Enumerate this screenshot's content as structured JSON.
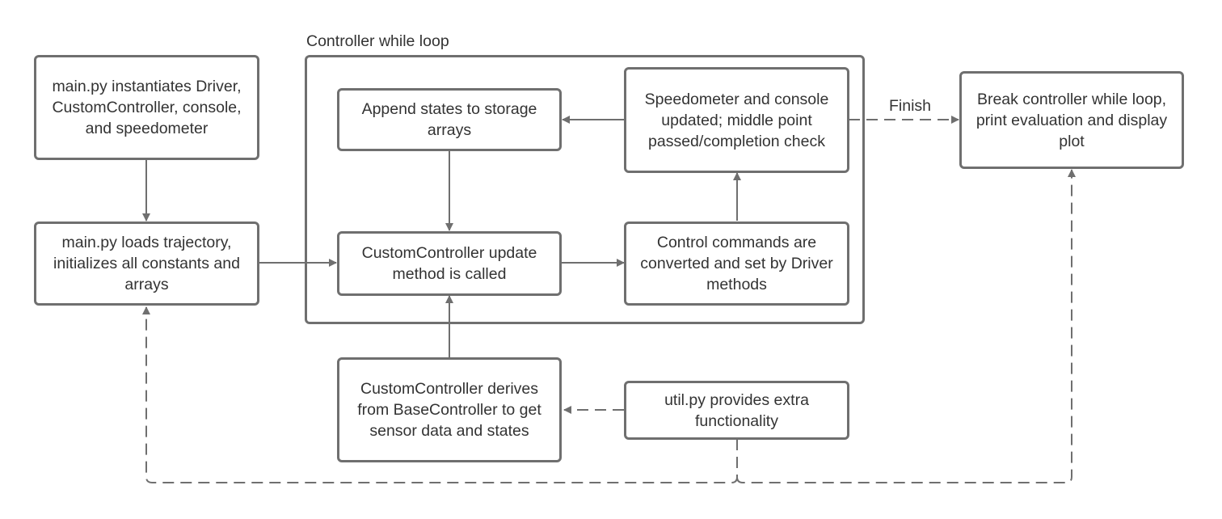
{
  "diagram": {
    "container": {
      "label": "Controller while loop"
    },
    "nodes": {
      "main_instantiates": "main.py instantiates Driver, CustomController, console, and speedometer",
      "main_loads": "main.py loads trajectory, initializes all constants and arrays",
      "append_states": "Append states to storage arrays",
      "speedometer_updated": "Speedometer and console updated; middle point passed/completion check",
      "update_called": "CustomController update method is called",
      "control_commands": "Control commands are converted and set by Driver methods",
      "derives_base": "CustomController derives from BaseController to get sensor data and states",
      "util_provides": "util.py provides extra functionality",
      "break_loop": "Break controller while loop, print evaluation and display plot"
    },
    "edge_labels": {
      "finish": "Finish"
    },
    "edges": [
      {
        "from": "main_instantiates",
        "to": "main_loads",
        "style": "solid"
      },
      {
        "from": "main_loads",
        "to": "update_called",
        "style": "solid"
      },
      {
        "from": "update_called",
        "to": "control_commands",
        "style": "solid"
      },
      {
        "from": "control_commands",
        "to": "speedometer_updated",
        "style": "solid"
      },
      {
        "from": "speedometer_updated",
        "to": "append_states",
        "style": "solid"
      },
      {
        "from": "append_states",
        "to": "update_called",
        "style": "solid"
      },
      {
        "from": "derives_base",
        "to": "update_called",
        "style": "solid"
      },
      {
        "from": "speedometer_updated",
        "to": "break_loop",
        "style": "dashed",
        "label": "Finish"
      },
      {
        "from": "util_provides",
        "to": "derives_base",
        "style": "dashed"
      },
      {
        "from": "util_provides",
        "to": "main_loads",
        "style": "dashed"
      },
      {
        "from": "util_provides",
        "to": "break_loop",
        "style": "dashed"
      }
    ]
  }
}
